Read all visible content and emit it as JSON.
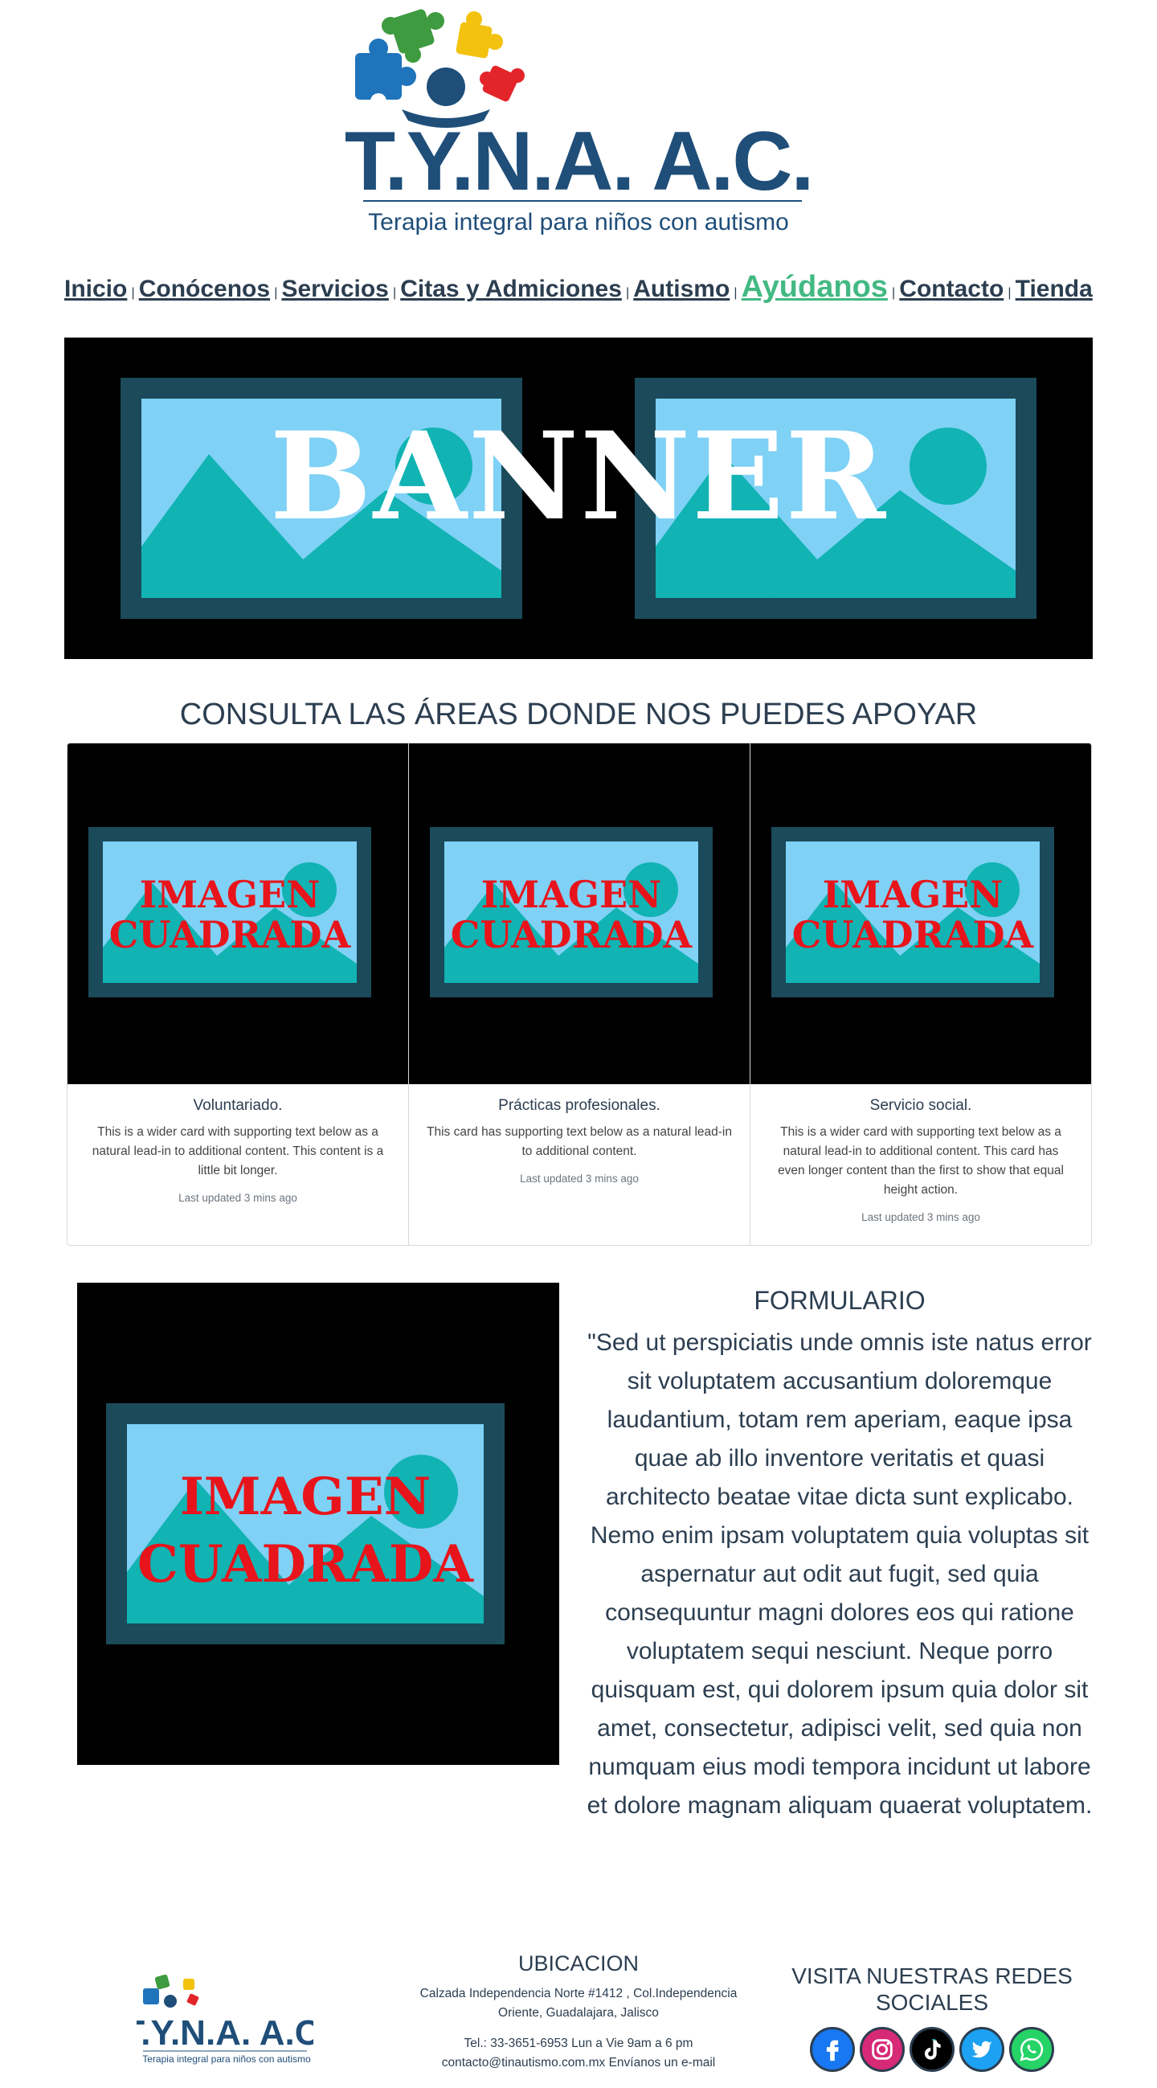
{
  "header": {
    "logo_letters": "T.Y.N.A. A.C.",
    "logo_tagline": "Terapia integral para niños con autismo"
  },
  "nav": {
    "items": [
      {
        "label": "Inicio"
      },
      {
        "label": "Conócenos"
      },
      {
        "label": "Servicios"
      },
      {
        "label": "Citas y Admiciones"
      },
      {
        "label": "Autismo"
      },
      {
        "label": "Ayúdanos"
      },
      {
        "label": "Contacto"
      },
      {
        "label": "Tienda"
      }
    ],
    "separator": "|",
    "active_color": "#42b983"
  },
  "banner": {
    "text": "BANNER"
  },
  "areas": {
    "title": "CONSULTA LAS ÁREAS DONDE NOS PUEDES APOYAR",
    "image_text_line1": "IMAGEN",
    "image_text_line2": "CUADRADA",
    "cards": [
      {
        "title": "Voluntariado.",
        "text": "This is a wider card with supporting text below as a natural lead-in to additional content. This content is a little bit longer.",
        "updated": "Last updated 3 mins ago"
      },
      {
        "title": "Prácticas profesionales.",
        "text": "This card has supporting text below as a natural lead-in to additional content.",
        "updated": "Last updated 3 mins ago"
      },
      {
        "title": "Servicio social.",
        "text": "This is a wider card with supporting text below as a natural lead-in to additional content. This card has even longer content than the first to show that equal height action.",
        "updated": "Last updated 3 mins ago"
      }
    ]
  },
  "form_section": {
    "image_text_line1": "IMAGEN",
    "image_text_line2": "CUADRADA",
    "title": "FORMULARIO",
    "body": "\"Sed ut perspiciatis unde omnis iste natus error sit voluptatem accusantium doloremque laudantium, totam rem aperiam, eaque ipsa quae ab illo inventore veritatis et quasi architecto beatae vitae dicta sunt explicabo. Nemo enim ipsam voluptatem quia voluptas sit aspernatur aut odit aut fugit, sed quia consequuntur magni dolores eos qui ratione voluptatem sequi nesciunt. Neque porro quisquam est, qui dolorem ipsum quia dolor sit amet, consectetur, adipisci velit, sed quia non numquam eius modi tempora incidunt ut labore et dolore magnam aliquam quaerat voluptatem."
  },
  "footer": {
    "logo_letters": "T.Y.N.A. A.C.",
    "logo_tagline": "Terapia integral para niños con autismo",
    "location_title": "UBICACION",
    "address_line1": "Calzada Independencia Norte #1412 , Col.Independencia",
    "address_line2": "Oriente, Guadalajara, Jalisco",
    "phone_line": "Tel.: 33-3651-6953 Lun a Vie 9am a 6 pm",
    "email_line": "contacto@tinautismo.com.mx Envíanos un e-mail",
    "social_title": "VISITA NUESTRAS REDES SOCIALES",
    "socials": [
      {
        "name": "facebook-icon",
        "color": "#1877f2"
      },
      {
        "name": "instagram-icon",
        "color": "#d62976"
      },
      {
        "name": "tiktok-icon",
        "color": "#000000"
      },
      {
        "name": "twitter-icon",
        "color": "#1da1f2"
      },
      {
        "name": "whatsapp-icon",
        "color": "#25d366"
      }
    ]
  }
}
